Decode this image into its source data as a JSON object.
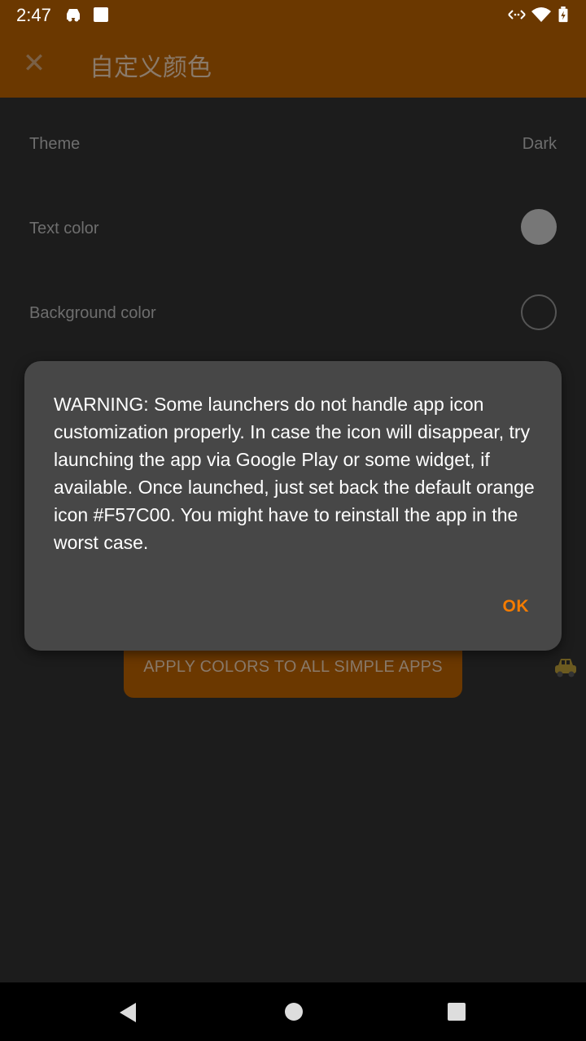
{
  "status_bar": {
    "time": "2:47",
    "icons": [
      "car-icon",
      "square-icon",
      "data-arrows-icon",
      "wifi-icon",
      "battery-icon"
    ]
  },
  "toolbar": {
    "title": "自定义颜色",
    "close_icon": "close-icon"
  },
  "settings": {
    "theme_label": "Theme",
    "theme_value": "Dark",
    "text_color_label": "Text color",
    "text_color_hex": "#777777",
    "background_color_label": "Background color",
    "background_color_hex": "#1c1c1c"
  },
  "apply_button": "APPLY COLORS TO ALL SIMPLE APPS",
  "dialog": {
    "message": "WARNING: Some launchers do not handle app icon customization properly. In case the icon will disappear, try launching the app via Google Play or some widget, if available. Once launched, just set back the default orange icon #F57C00. You might have to reinstall the app in the worst case.",
    "ok_label": "OK"
  },
  "colors": {
    "toolbar": "#6b3800",
    "accent": "#f57c00",
    "dialog_bg": "#474747",
    "page_bg": "#1c1c1c"
  }
}
